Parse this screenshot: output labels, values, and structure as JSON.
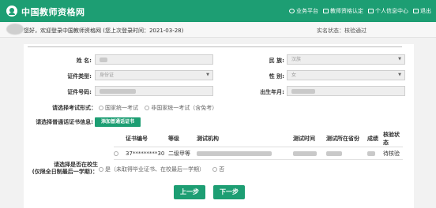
{
  "header": {
    "site_title": "中国教师资格网",
    "nav": [
      {
        "label": "业务平台",
        "icon": "info-circle-icon"
      },
      {
        "label": "教师资格认定",
        "icon": "monitor-icon"
      },
      {
        "label": "个人信息中心",
        "icon": "monitor-icon"
      },
      {
        "label": "退出",
        "icon": "logout-icon"
      }
    ]
  },
  "welcome": {
    "text": "您好，欢迎登录中国教师资格网 (您上次登录时间：2021-03-28)",
    "realname_status": "实名状态：核验通过"
  },
  "form": {
    "name_label": "姓 名:",
    "ethnicity_label": "民 族:",
    "ethnicity_value": "汉族",
    "id_type_label": "证件类型:",
    "id_type_value": "身份证",
    "gender_label": "性 别:",
    "gender_value": "女",
    "id_number_label": "证件号码:",
    "birth_label": "出生年月:",
    "exam_form_label": "请选择考试形式：",
    "exam_form_options": [
      "国家统一考试",
      "非国家统一考试（含免考）"
    ],
    "mandarin_label": "请选择普通话证书信息:",
    "add_mandarin_button": "添加普通话证书"
  },
  "mandarin_table": {
    "columns": [
      "证书编号",
      "等级",
      "测试机构",
      "测试时间",
      "测试所在省份",
      "成绩",
      "核验状态"
    ],
    "rows": [
      {
        "cert_no": "37*********30",
        "level": "二级甲等",
        "status": "待核验"
      }
    ]
  },
  "enrollment": {
    "label_line1": "请选择是否在校生",
    "label_line2": "(仅限全日制最后一学期)：",
    "options": [
      "是（未取得毕业证书、在校最后一学期）",
      "否"
    ]
  },
  "actions": {
    "prev": "上一步",
    "next": "下一步"
  }
}
